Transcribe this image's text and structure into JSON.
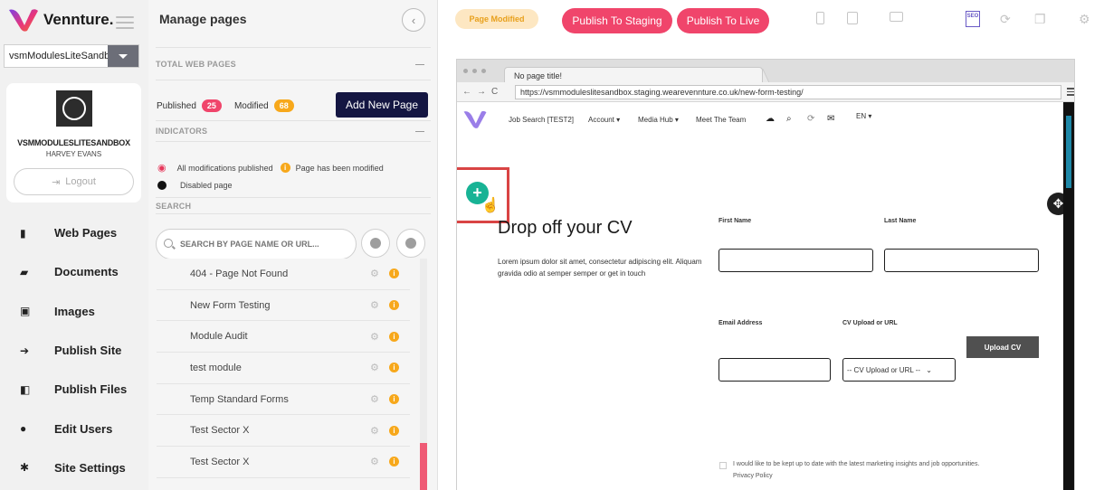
{
  "brand": {
    "name": "Vennture."
  },
  "sidebar": {
    "site_select": "vsmModulesLiteSandbox",
    "profile": {
      "site_name": "VSMMODULESLITESANDBOX",
      "user_name": "HARVEY EVANS",
      "logout_label": "Logout"
    },
    "nav": [
      {
        "label": "Web Pages",
        "icon": "document-icon",
        "glyph": "▮"
      },
      {
        "label": "Documents",
        "icon": "folder-icon",
        "glyph": "▰"
      },
      {
        "label": "Images",
        "icon": "image-icon",
        "glyph": "▣"
      },
      {
        "label": "Publish Site",
        "icon": "publish-site-icon",
        "glyph": "➔"
      },
      {
        "label": "Publish Files",
        "icon": "publish-files-icon",
        "glyph": "◧"
      },
      {
        "label": "Edit Users",
        "icon": "user-icon",
        "glyph": "●"
      },
      {
        "label": "Site Settings",
        "icon": "gear-icon",
        "glyph": "✱"
      }
    ]
  },
  "panel": {
    "title": "Manage pages",
    "total_heading": "TOTAL WEB PAGES",
    "published_label": "Published",
    "published_count": "25",
    "modified_label": "Modified",
    "modified_count": "68",
    "add_page_label": "Add New Page",
    "indicators_heading": "INDICATORS",
    "indicator_published": "All modifications published",
    "indicator_modified": "Page has been modified",
    "indicator_disabled": "Disabled page",
    "search_heading": "SEARCH",
    "search_placeholder": "SEARCH BY PAGE NAME OR URL...",
    "pages": [
      "404 - Page Not Found",
      "New Form Testing",
      "Module Audit",
      "test module",
      "Temp Standard Forms",
      "Test Sector X",
      "Test Sector X"
    ]
  },
  "toolbar": {
    "status": "Page Modified",
    "publish_staging": "Publish To Staging",
    "publish_live": "Publish To Live"
  },
  "browser": {
    "tab_title": "No page title!",
    "url": "https://vsmmoduleslitesandbox.staging.wearevennture.co.uk/new-form-testing/"
  },
  "site": {
    "nav_links": [
      "Job Search [TEST2]",
      "Account ▾",
      "Media Hub ▾",
      "Meet The Team"
    ],
    "lang": "EN ▾",
    "form_title": "Drop off your CV",
    "form_desc": "Lorem ipsum dolor sit amet, consectetur adipiscing elit. Aliquam gravida odio at semper semper or get in touch",
    "first_name_label": "First Name",
    "last_name_label": "Last Name",
    "email_label": "Email Address",
    "cv_label": "CV Upload or URL",
    "upload_label": "Upload CV",
    "cv_select_value": "-- CV Upload or URL --",
    "consent_text": "I would like to be kept up to date with the latest marketing insights and job opportunities.",
    "privacy_text": "Privacy Policy"
  },
  "colors": {
    "accent_pink": "#f0456b",
    "navy": "#141642",
    "teal": "#18b395",
    "warning": "#f7a81b"
  }
}
